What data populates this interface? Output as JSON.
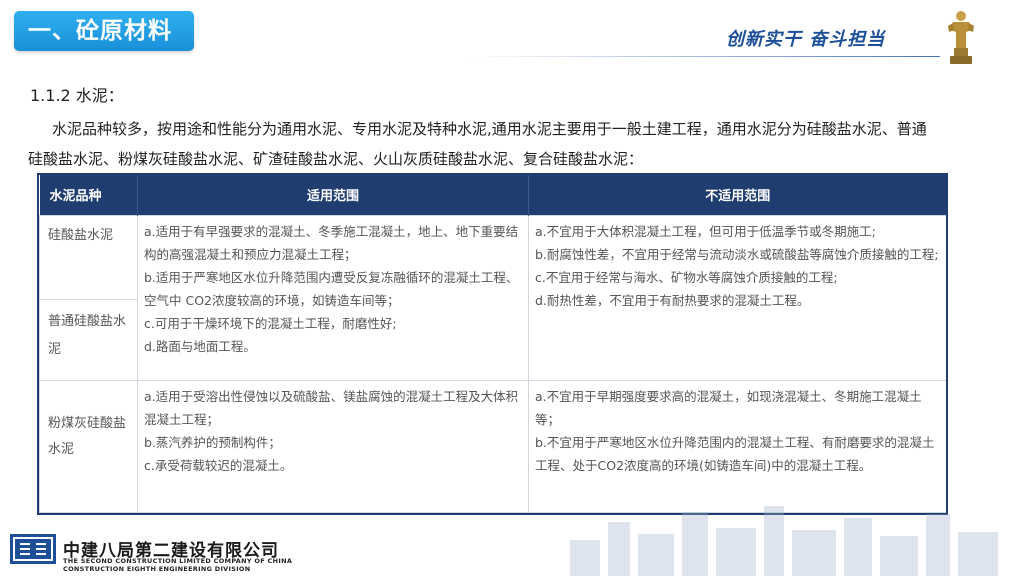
{
  "header": {
    "section_title": "一、砼原材料",
    "slogan": "创新实干 奋斗担当"
  },
  "content": {
    "subheading": "1.1.2 水泥：",
    "intro": "水泥品种较多，按用途和性能分为通用水泥、专用水泥及特种水泥,通用水泥主要用于一般土建工程，通用水泥分为硅酸盐水泥、普通硅酸盐水泥、粉煤灰硅酸盐水泥、矿渣硅酸盐水泥、火山灰质硅酸盐水泥、复合硅酸盐水泥："
  },
  "table": {
    "headers": [
      "水泥品种",
      "适用范围",
      "不适用范围"
    ],
    "rows": [
      {
        "kinds": [
          "硅酸盐水泥",
          "普通硅酸盐水泥"
        ],
        "suitable": [
          "a.适用于有早强要求的混凝土、冬季施工混凝土，地上、地下重要结构的高强混凝土和预应力混凝土工程；",
          "b.适用于严寒地区水位升降范围内遭受反复冻融循环的混凝土工程、空气中 CO2浓度较高的环境，如铸造车间等；",
          "c.可用于干燥环境下的混凝土工程，耐磨性好;",
          "d.路面与地面工程。"
        ],
        "unsuitable": [
          "a.不宜用于大体积混凝土工程，但可用于低温季节或冬期施工;",
          "b.耐腐蚀性差，不宜用于经常与流动淡水或硫酸盐等腐蚀介质接触的工程;",
          "c.不宜用于经常与海水、矿物水等腐蚀介质接触的工程;",
          "d.耐热性差，不宜用于有耐热要求的混凝土工程。"
        ]
      },
      {
        "kinds": [
          "粉煤灰硅酸盐水泥"
        ],
        "suitable": [
          "a.适用于受溶出性侵蚀以及硫酸盐、镁盐腐蚀的混凝土工程及大体积混凝土工程；",
          "b.蒸汽养护的预制构件；",
          "c.承受荷载较迟的混凝土。"
        ],
        "unsuitable": [
          "a.不宜用于早期强度要求高的混凝土，如现浇混凝土、冬期施工混凝土等；",
          "b.不宜用于严寒地区水位升降范围内的混凝土工程、有耐磨要求的混凝土工程、处于CO2浓度高的环境(如铸造车间)中的混凝土工程。"
        ]
      }
    ]
  },
  "footer": {
    "company_cn": "中建八局第二建设有限公司",
    "company_en_1": "THE SECOND CONSTRUCTION LIMITED COMPANY OF CHINA",
    "company_en_2": "CONSTRUCTION EIGHTH ENGINEERING DIVISION"
  },
  "colors": {
    "title_blue": "#1a8fd8",
    "table_header": "#1f3d6e",
    "slogan_blue": "#1d4f99"
  },
  "icons": [
    "trophy-statue-icon",
    "company-logo-icon",
    "city-skyline-image"
  ]
}
